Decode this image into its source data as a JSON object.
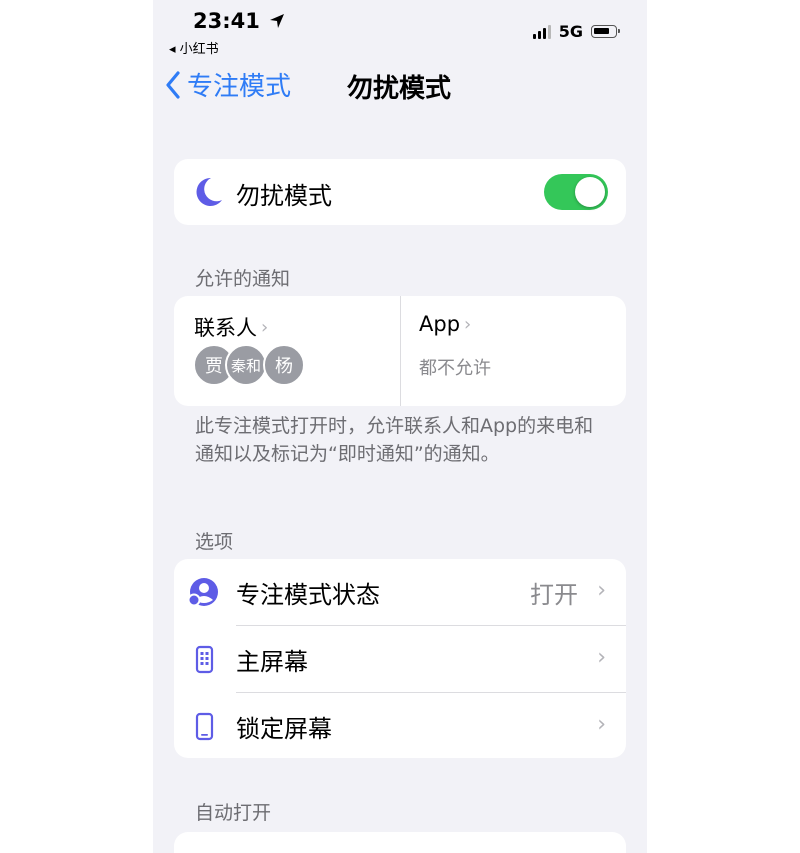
{
  "status_bar": {
    "time": "23:41",
    "back_app": "◂ 小红书",
    "network": "5G"
  },
  "nav": {
    "back_label": "专注模式",
    "title": "勿扰模式"
  },
  "focus_toggle": {
    "label": "勿扰模式",
    "enabled": true,
    "accent_color": "#34c759"
  },
  "allowed_notifications": {
    "header": "允许的通知",
    "contacts": {
      "label": "联系人",
      "avatars": [
        "贾",
        "秦和",
        "杨"
      ]
    },
    "apps": {
      "label": "App",
      "value": "都不允许"
    },
    "footnote": "此专注模式打开时，允许联系人和App的来电和通知以及标记为“即时通知”的通知。"
  },
  "options": {
    "header": "选项",
    "items": [
      {
        "label": "专注模式状态",
        "value": "打开",
        "icon": "focus-status-icon"
      },
      {
        "label": "主屏幕",
        "value": "",
        "icon": "home-screen-icon"
      },
      {
        "label": "锁定屏幕",
        "value": "",
        "icon": "lock-screen-icon"
      }
    ]
  },
  "auto_on": {
    "header": "自动打开"
  },
  "colors": {
    "accent_blue": "#2f7cf6",
    "moon_purple": "#5e5ce6",
    "background": "#f2f2f7"
  }
}
